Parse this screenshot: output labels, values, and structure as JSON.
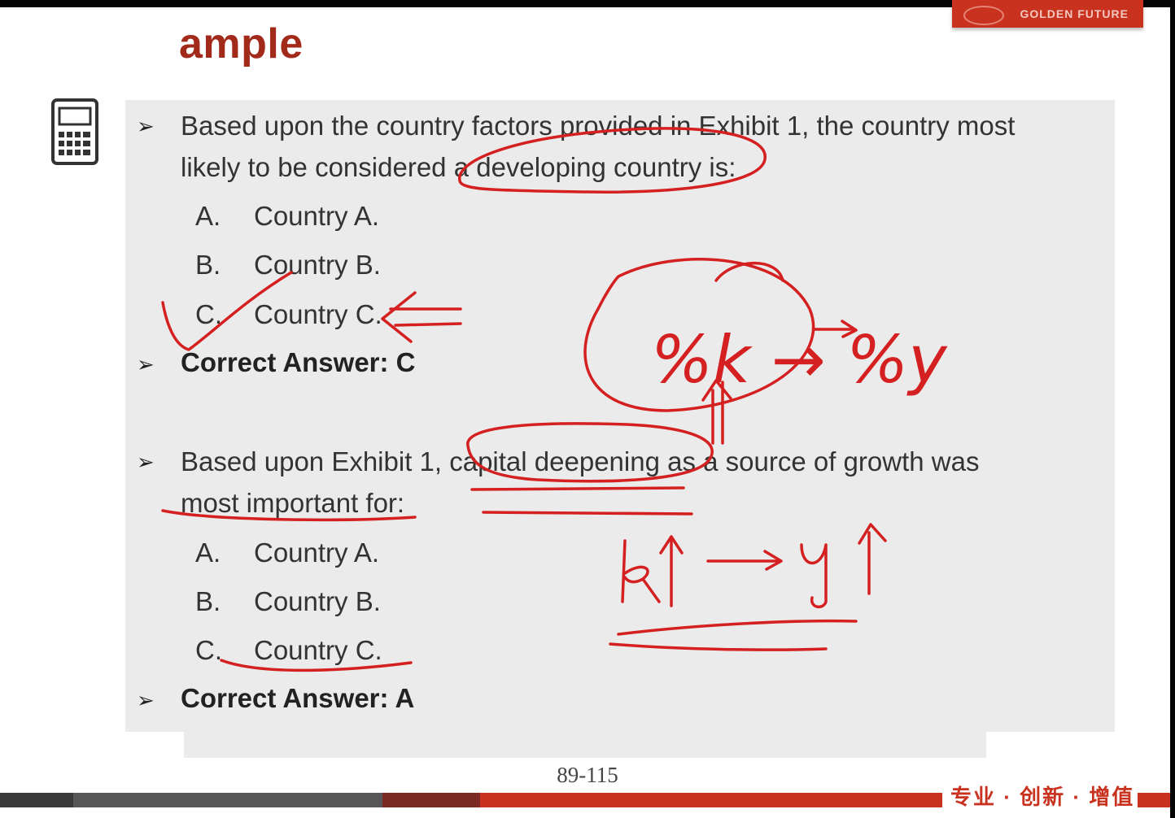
{
  "header": {
    "title": "ample",
    "brand": "GOLDEN FUTURE"
  },
  "icons": {
    "calculator": "calculator-icon",
    "bullet": "arrow-bullet-icon"
  },
  "question1": {
    "line1": "Based upon the country factors provided in Exhibit 1, the country most",
    "line2": "likely to be considered a developing country is:",
    "options": [
      {
        "letter": "A.",
        "text": "Country A."
      },
      {
        "letter": "B.",
        "text": "Country B."
      },
      {
        "letter": "C.",
        "text": "Country C."
      }
    ],
    "answer": "Correct Answer: C"
  },
  "question2": {
    "line1": "Based upon Exhibit 1, capital deepening as a source of growth was",
    "line2": "most important for:",
    "options": [
      {
        "letter": "A.",
        "text": "Country A."
      },
      {
        "letter": "B.",
        "text": "Country B."
      },
      {
        "letter": "C.",
        "text": "Country C."
      }
    ],
    "answer": "Correct Answer: A"
  },
  "handwriting": {
    "note1": "%k → %y",
    "note2": "k↑ → y↑"
  },
  "footer": {
    "page": "89-115",
    "motto": "专业 · 创新 · 增值"
  },
  "colors": {
    "accent": "#c8321f",
    "title": "#a22a1a",
    "panel": "#ebebeb",
    "ink": "#d42020"
  }
}
